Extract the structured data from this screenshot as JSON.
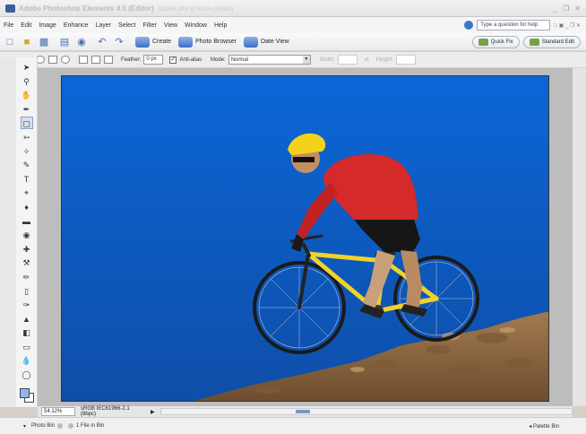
{
  "title": {
    "app": "Adobe Photoshop Elements 4.0 (Editor)",
    "file": "013456.JPG @ 54.1% (RGB/8)",
    "controls": [
      "_",
      "❐",
      "✕"
    ]
  },
  "menu": {
    "items": [
      "File",
      "Edit",
      "Image",
      "Enhance",
      "Layer",
      "Select",
      "Filter",
      "View",
      "Window",
      "Help"
    ],
    "question_placeholder": "Type a question for help",
    "mini_controls": "□ ▣ _ ❐ ✕"
  },
  "shortcuts": {
    "create_label": "Create",
    "photo_browser_label": "Photo Browser",
    "date_view_label": "Date View",
    "quick_fix_label": "Quick Fix",
    "standard_edit_label": "Standard Edit"
  },
  "options": {
    "feather_label": "Feather:",
    "feather_value": "0 px",
    "antialias_label": "Anti-alias",
    "antialias_checked": "✓",
    "mode_label": "Mode:",
    "mode_value": "Normal",
    "width_label": "Width:",
    "height_label": "Height:"
  },
  "status": {
    "zoom": "54.12%",
    "info": "sRGB IEC61966-2.1 (8bpc)"
  },
  "palette_bin": {
    "left_label": "Photo Bin",
    "count_label": "1 File in Bin",
    "right_label": "Palette Bin"
  },
  "colors": {
    "sky_top": "#0a5fcf",
    "sky_bottom": "#0f4fa6",
    "jersey": "#d42a2a",
    "helmet": "#f2d21a",
    "bike_frame": "#f0d22a",
    "rock": "#8f6a44"
  }
}
